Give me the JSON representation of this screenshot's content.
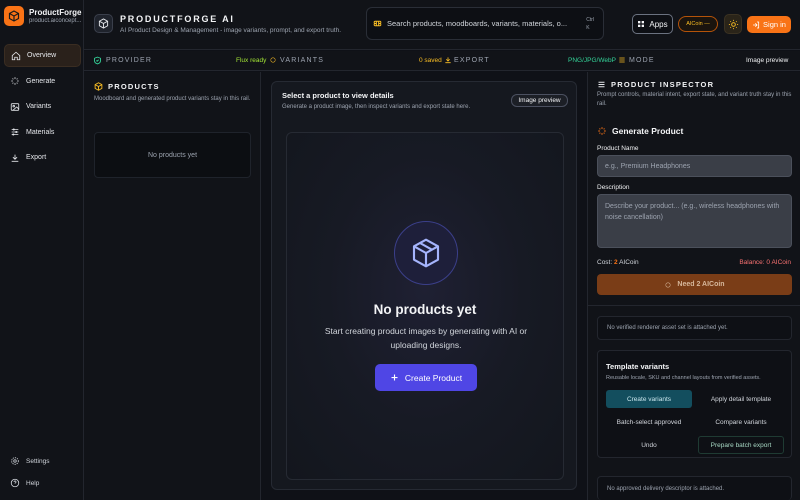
{
  "brand": {
    "name": "ProductForge",
    "url": "product.aiconcept..."
  },
  "sidebar": {
    "items": [
      {
        "label": "Overview",
        "icon": "home-icon"
      },
      {
        "label": "Generate",
        "icon": "sparkles-icon"
      },
      {
        "label": "Variants",
        "icon": "image-icon"
      },
      {
        "label": "Materials",
        "icon": "sliders-icon"
      },
      {
        "label": "Export",
        "icon": "download-icon"
      }
    ],
    "bottom": [
      {
        "label": "Settings",
        "icon": "gear-icon"
      },
      {
        "label": "Help",
        "icon": "help-icon"
      }
    ]
  },
  "header": {
    "title": "PRODUCTFORGE AI",
    "subtitle": "AI Product Design & Management - image variants, prompt, and export truth.",
    "search_placeholder": "Search products, moodboards, variants, materials, o...",
    "kbd_top": "Ctrl",
    "kbd_bottom": "K",
    "apps_label": "Apps",
    "aicoin_label": "AICoin —",
    "signin_label": "Sign in"
  },
  "statusbar": {
    "provider_key": "PROVIDER",
    "provider_value": "Flux ready",
    "variants_key": "VARIANTS",
    "variants_value": "0 saved",
    "export_key": "EXPORT",
    "export_value": "PNG/JPG/WebP",
    "mode_key": "MODE",
    "mode_value": "Image preview"
  },
  "products": {
    "title": "PRODUCTS",
    "description": "Moodboard and generated product variants stay in this rail.",
    "empty": "No products yet"
  },
  "center": {
    "title": "Select a product to view details",
    "subtitle": "Generate a product image, then inspect variants and export state here.",
    "preview_button": "Image preview",
    "empty_title": "No products yet",
    "empty_desc": "Start creating product images by generating with AI or uploading designs.",
    "create_button": "Create Product"
  },
  "inspector": {
    "title": "PRODUCT INSPECTOR",
    "description": "Prompt controls, material intent, export state, and variant truth stay in this rail.",
    "generate_title": "Generate Product",
    "name_label": "Product Name",
    "name_placeholder": "e.g., Premium Headphones",
    "desc_label": "Description",
    "desc_placeholder": "Describe your product... (e.g., wireless headphones with noise cancellation)",
    "cost_prefix": "Cost:",
    "cost_value": "2",
    "cost_suffix": "AICoin",
    "balance": "Balance: 0 AICoin",
    "need_button": "Need 2 AICoin",
    "renderer_note": "No verified renderer asset set is attached yet.",
    "template": {
      "title": "Template variants",
      "subtitle": "Reusable locale, SKU and channel layouts from verified assets.",
      "buttons": [
        "Create variants",
        "Apply detail template",
        "Batch-select approved",
        "Compare variants",
        "Undo",
        "Prepare batch export"
      ]
    },
    "delivery_note": "No approved delivery descriptor is attached."
  },
  "colors": {
    "accent": "#f97316",
    "primary": "#4f46e5",
    "ready": "#a3e635",
    "saved": "#fbbf24",
    "export": "#34d399",
    "danger": "#f87171"
  }
}
